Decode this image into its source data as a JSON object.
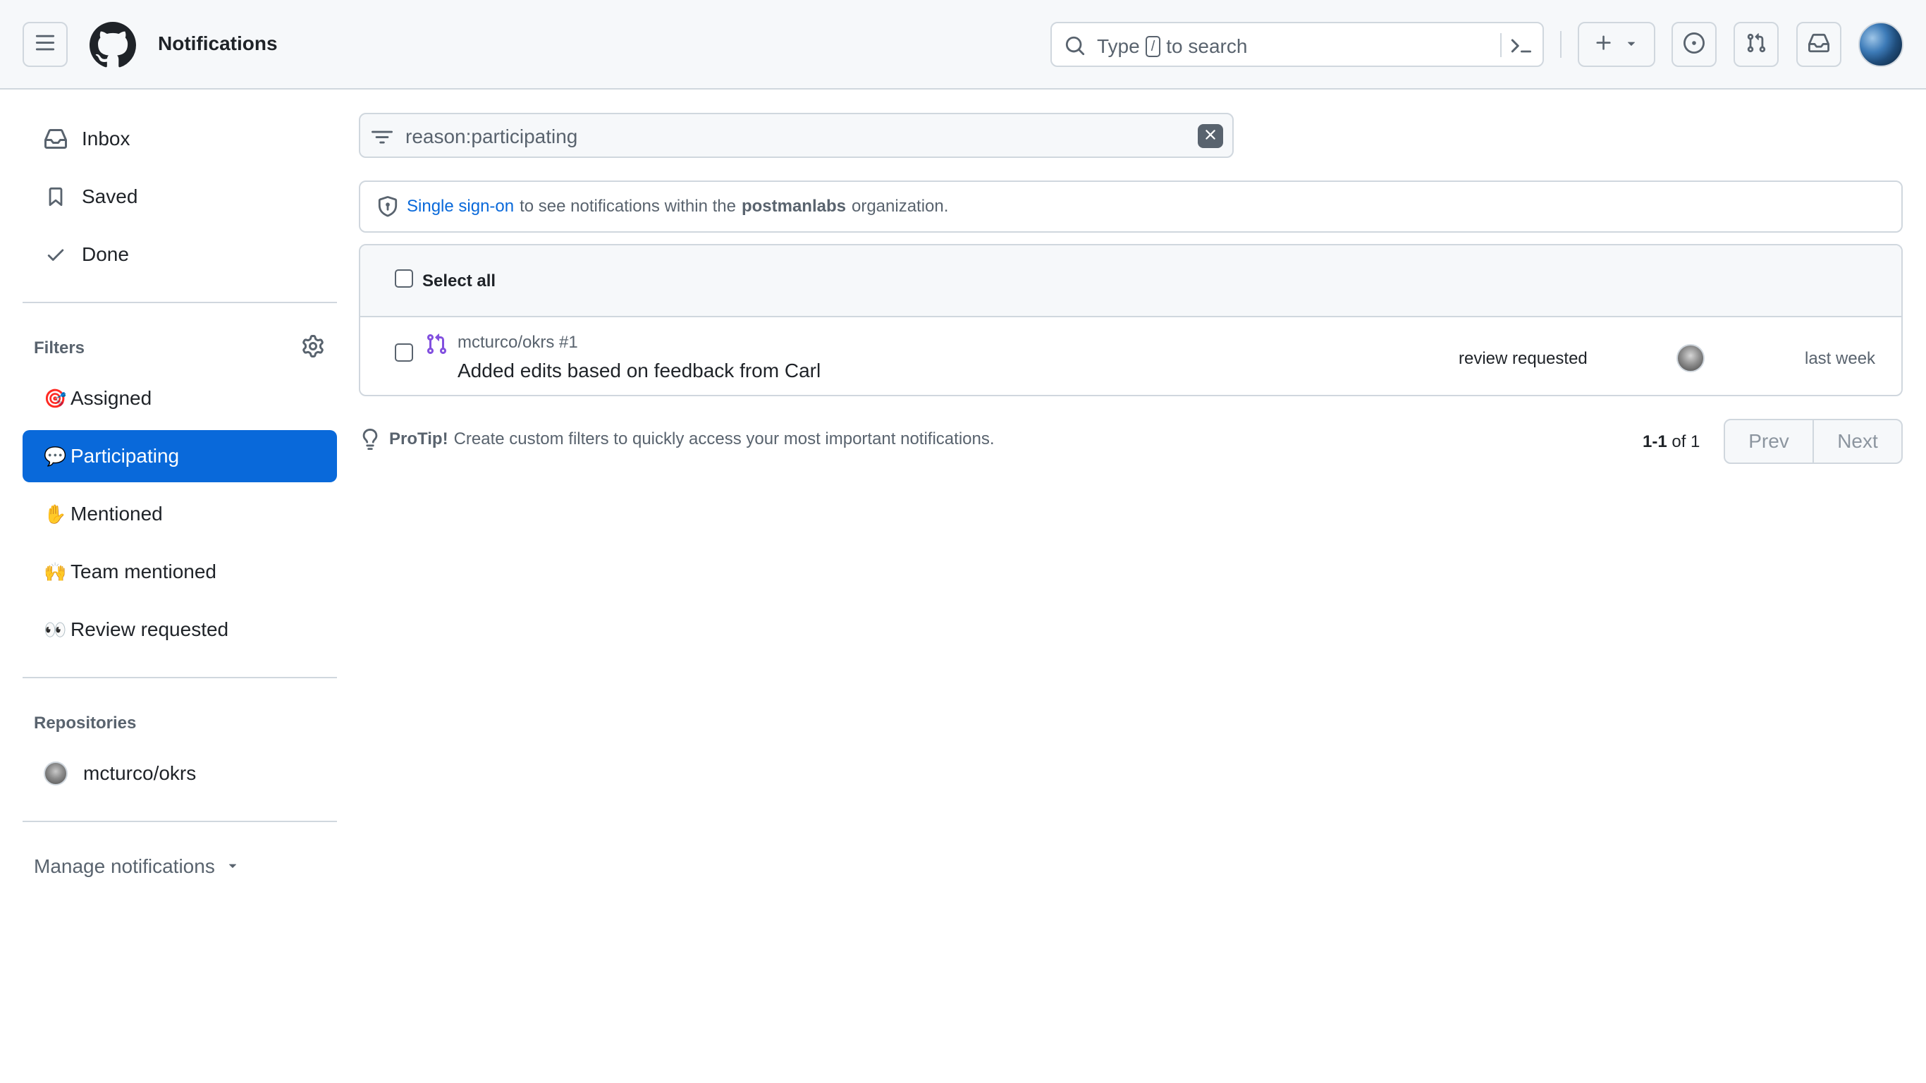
{
  "header": {
    "title": "Notifications",
    "search": {
      "prefix": "Type",
      "key": "/",
      "suffix": "to search"
    },
    "icons": [
      "hamburger-icon",
      "github-logo",
      "search-icon",
      "command-palette-icon",
      "plus-icon",
      "triangle-down-icon",
      "issue-icon",
      "pull-request-icon",
      "inbox-icon",
      "user-avatar"
    ]
  },
  "sidebar": {
    "inbox": [
      {
        "label": "Inbox",
        "icon": "inbox-icon"
      },
      {
        "label": "Saved",
        "icon": "bookmark-icon"
      },
      {
        "label": "Done",
        "icon": "check-icon"
      }
    ],
    "filters_title": "Filters",
    "filters": [
      {
        "emoji": "🎯",
        "label": "Assigned",
        "active": false
      },
      {
        "emoji": "💬",
        "label": "Participating",
        "active": true
      },
      {
        "emoji": "✋",
        "label": "Mentioned",
        "active": false
      },
      {
        "emoji": "🙌",
        "label": "Team mentioned",
        "active": false
      },
      {
        "emoji": "👀",
        "label": "Review requested",
        "active": false
      }
    ],
    "repositories_title": "Repositories",
    "repositories": [
      {
        "label": "mcturco/okrs"
      }
    ],
    "manage_label": "Manage notifications"
  },
  "main": {
    "filter_query": "reason:participating",
    "sso": {
      "link": "Single sign-on",
      "text_before_org": "to see notifications within the",
      "org": "postmanlabs",
      "text_after_org": "organization."
    },
    "select_all_label": "Select all",
    "notifications": [
      {
        "repo": "mcturco/okrs #1",
        "title": "Added edits based on feedback from Carl",
        "reason": "review requested",
        "time": "last week",
        "type_icon": "git-pull-request-icon"
      }
    ],
    "protip": {
      "label": "ProTip!",
      "text": "Create custom filters to quickly access your most important notifications."
    },
    "pagination": {
      "range": "1-1",
      "of_word": "of",
      "total": "1",
      "prev_label": "Prev",
      "next_label": "Next"
    }
  },
  "colors": {
    "accent": "#0969da",
    "border": "#d0d7de",
    "muted": "#59636e",
    "header_bg": "#f6f8fa",
    "pr_icon": "#8250df"
  }
}
